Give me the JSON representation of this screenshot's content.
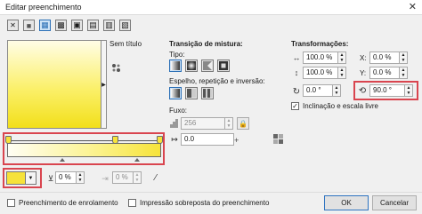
{
  "window": {
    "title": "Editar preenchimento",
    "close_glyph": "✕"
  },
  "fill_types": [
    {
      "name": "no-fill",
      "glyph": "✕"
    },
    {
      "name": "uniform-fill",
      "glyph": "■"
    },
    {
      "name": "fountain-fill",
      "glyph": "▦"
    },
    {
      "name": "vector-fill",
      "glyph": "▩"
    },
    {
      "name": "bitmap-fill",
      "glyph": "▣"
    },
    {
      "name": "two-color-fill",
      "glyph": "▤"
    },
    {
      "name": "texture-fill",
      "glyph": "▥"
    },
    {
      "name": "postscript-fill",
      "glyph": "▧"
    }
  ],
  "preview": {
    "name": "Sem título",
    "dropdown_glyph": "▶",
    "colors": [
      "#fffde6",
      "#f2df1a"
    ]
  },
  "blend": {
    "header": "Transição de mistura:",
    "type_label": "Tipo:",
    "mirror_label": "Espelho, repetição e inversão:",
    "flow_label": "Fuxo:",
    "steps_value": "256",
    "acceleration_value": "0.0"
  },
  "transform": {
    "header": "Transformações:",
    "width_value": "100.0 %",
    "height_value": "100.0 %",
    "x_label": "X:",
    "x_value": "0.0 %",
    "y_label": "Y:",
    "y_value": "0.0 %",
    "skew_value": "0.0 °",
    "rotate_value": "90.0 °",
    "free_scale_label": "Inclinação e escala livre",
    "free_scale_checked": true
  },
  "node": {
    "color": "#f6e23a",
    "opacity_value": "0 %",
    "position_value": "0 %"
  },
  "footer": {
    "wrap_label": "Preenchimento de enrolamento",
    "overprint_label": "Impressão sobreposta do preenchimento",
    "ok_label": "OK",
    "cancel_label": "Cancelar"
  },
  "colors": {
    "accent": "#2b6fb6",
    "highlight": "#d9454f",
    "fill_yellow": "#f6e23a"
  }
}
